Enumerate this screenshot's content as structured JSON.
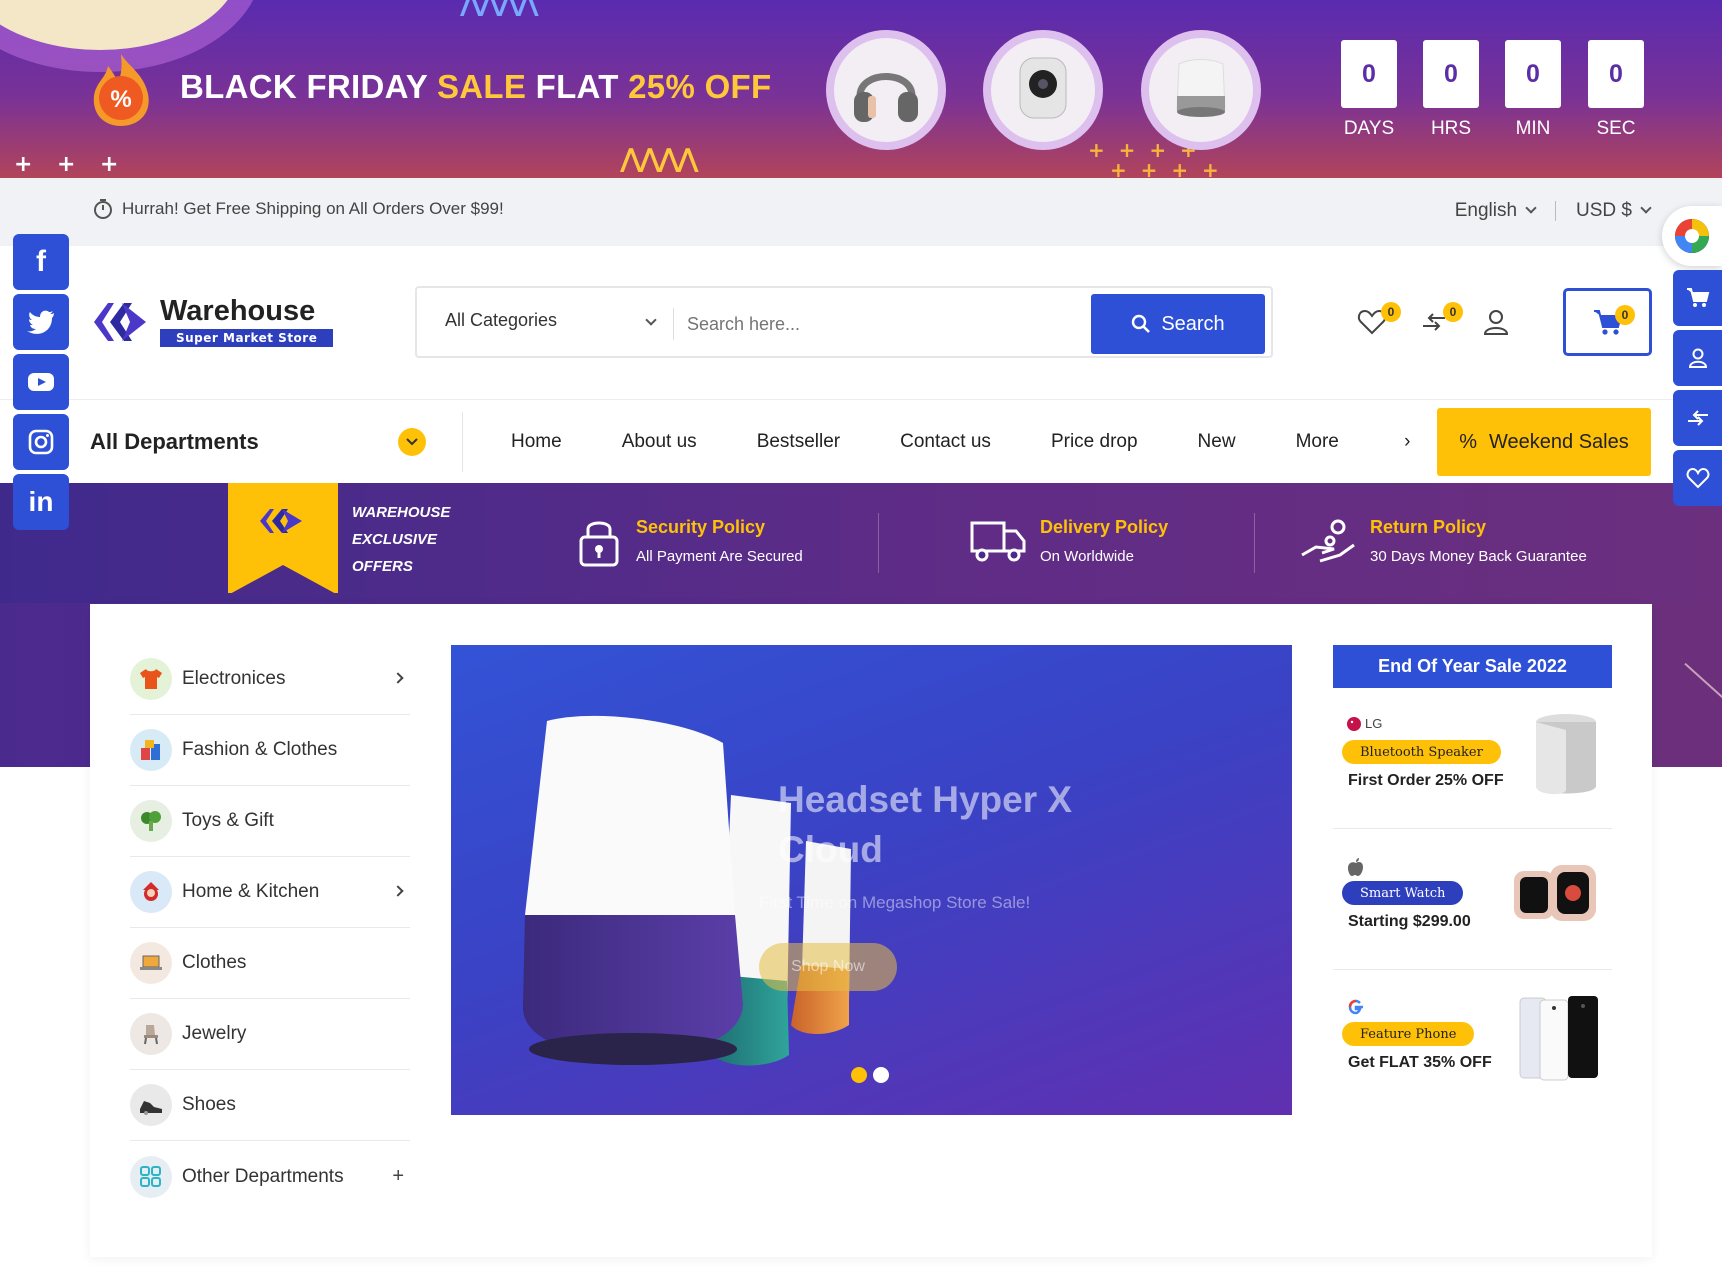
{
  "promo": {
    "title_white_1": "BLACK FRIDAY ",
    "title_yellow_1": "SALE",
    "title_white_2": " FLAT ",
    "title_yellow_2": "25% OFF",
    "badge_symbol": "%",
    "countdown": [
      {
        "value": "0",
        "label": "DAYS"
      },
      {
        "value": "0",
        "label": "HRS"
      },
      {
        "value": "0",
        "label": "MIN"
      },
      {
        "value": "0",
        "label": "SEC"
      }
    ]
  },
  "infobar": {
    "shipping_text": "Hurrah! Get Free Shipping on All Orders Over $99!",
    "language": "English",
    "currency": "USD $"
  },
  "social": [
    "f",
    "twitter-icon",
    "youtube-icon",
    "instagram-icon",
    "in"
  ],
  "header": {
    "logo_name": "Warehouse",
    "logo_tagline": "Super Market Store",
    "category_select": "All Categories",
    "search_placeholder": "Search here...",
    "search_button": "Search",
    "wishlist_count": "0",
    "compare_count": "0",
    "cart_count": "0"
  },
  "nav": {
    "all_departments": "All Departments",
    "links": [
      "Home",
      "About us",
      "Bestseller",
      "Contact us",
      "Price drop",
      "New",
      "More"
    ],
    "weekend_sales": "Weekend Sales",
    "weekend_symbol": "%"
  },
  "band": {
    "exclusive_lines": [
      "WAREHOUSE",
      "EXCLUSIVE",
      "OFFERS"
    ],
    "policies": [
      {
        "title": "Security Policy",
        "subtitle": "All Payment Are Secured",
        "icon": "lock-icon"
      },
      {
        "title": "Delivery Policy",
        "subtitle": "On Worldwide",
        "icon": "truck-icon"
      },
      {
        "title": "Return Policy",
        "subtitle": "30 Days Money Back Guarantee",
        "icon": "hand-return-icon"
      }
    ]
  },
  "categories": [
    {
      "label": "Electronices",
      "has_arrow": true
    },
    {
      "label": "Fashion & Clothes",
      "has_arrow": false
    },
    {
      "label": "Toys & Gift",
      "has_arrow": false
    },
    {
      "label": "Home & Kitchen",
      "has_arrow": true
    },
    {
      "label": "Clothes",
      "has_arrow": false
    },
    {
      "label": "Jewelry",
      "has_arrow": false
    },
    {
      "label": "Shoes",
      "has_arrow": false
    },
    {
      "label": "Other Departments",
      "has_plus": true
    }
  ],
  "slider": {
    "title": "Headset Hyper X Cloud",
    "subtitle": "First Time on Megashop Store Sale!",
    "button": "Shop Now",
    "dots": 2,
    "active_dot": 0
  },
  "sidebox": {
    "heading": "End Of Year Sale 2022",
    "items": [
      {
        "brand": "LG",
        "pill": "Bluetooth Speaker",
        "text": "First Order 25% OFF"
      },
      {
        "brand": "",
        "pill": "Smart Watch",
        "text": "Starting $299.00"
      },
      {
        "brand": "",
        "pill": "Feature Phone",
        "text": "Get FLAT 35% OFF"
      }
    ]
  },
  "colors": {
    "primary_blue": "#2e50d6",
    "accent_yellow": "#ffc107",
    "band_purple": "#4b2a8e"
  }
}
